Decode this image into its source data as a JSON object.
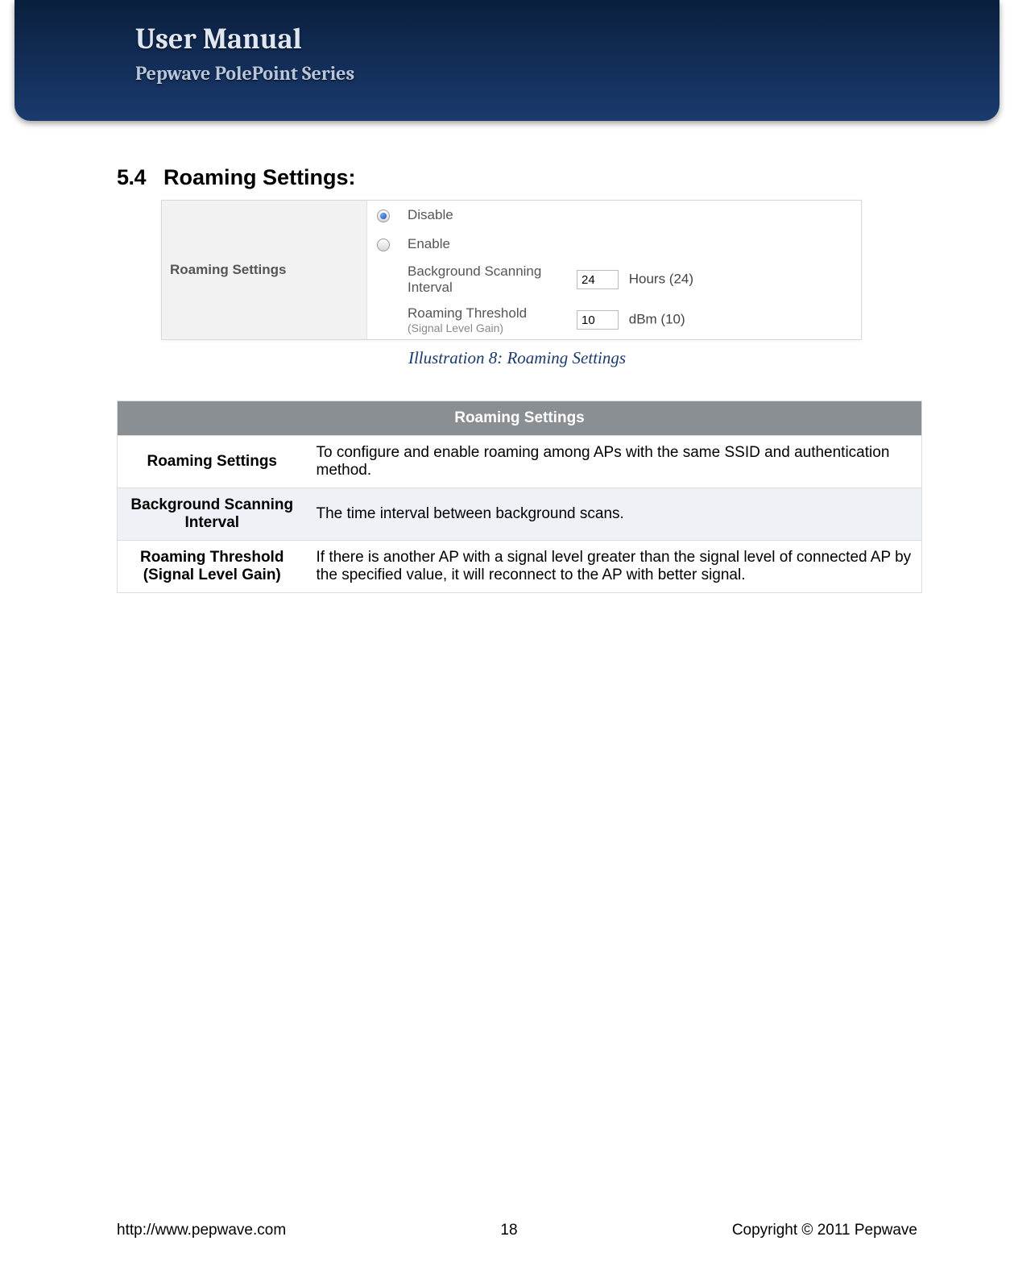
{
  "header": {
    "title": "User Manual",
    "subtitle": "Pepwave PolePoint Series"
  },
  "section": {
    "number": "5.4",
    "title": "Roaming Settings:"
  },
  "settings_panel": {
    "label": "Roaming Settings",
    "options": {
      "disable": "Disable",
      "enable": "Enable"
    },
    "rows": [
      {
        "label": "Background Scanning Interval",
        "value": "24",
        "unit": "Hours (24)"
      },
      {
        "label_line1": "Roaming Threshold",
        "label_line2": "(Signal Level Gain)",
        "value": "10",
        "unit": "dBm (10)"
      }
    ]
  },
  "caption": "Illustration 8: Roaming Settings",
  "desc": {
    "header": "Roaming Settings",
    "rows": [
      {
        "label": "Roaming Settings",
        "text": "To configure and enable roaming among APs with the same SSID and authentication method."
      },
      {
        "label": "Background Scanning Interval",
        "text": "The time interval between background scans."
      },
      {
        "label": "Roaming Threshold (Signal Level Gain)",
        "text": "If there is another AP with a signal level greater than the signal level of connected AP by the specified value, it will reconnect to the AP with better signal."
      }
    ]
  },
  "footer": {
    "url": "http://www.pepwave.com",
    "page": "18",
    "copyright": "Copyright © 2011 Pepwave"
  }
}
